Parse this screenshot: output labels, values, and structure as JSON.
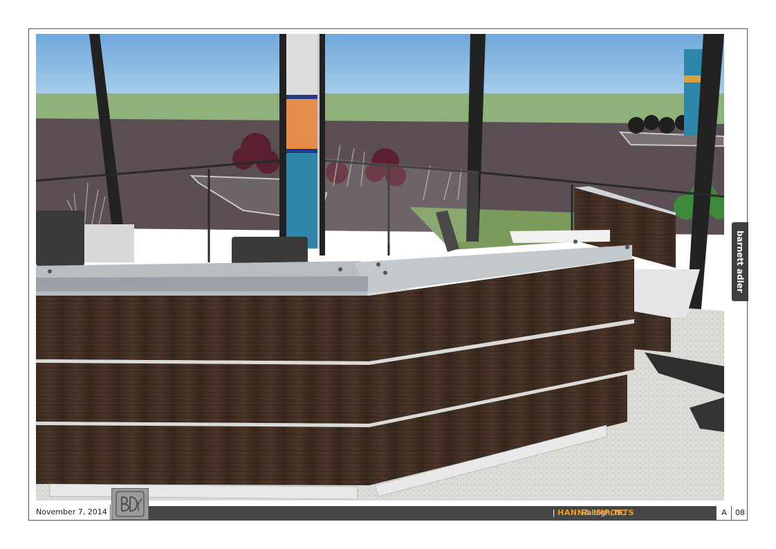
{
  "footer": {
    "date": "November 7, 2014",
    "location": "Raleigh, NC",
    "separator": "|",
    "client": "HANNA IMPORTS",
    "sheet_letter": "A",
    "page_number": "08"
  },
  "side_tab": {
    "brand": "barnett adler"
  },
  "logo": {
    "monogram": "BDY"
  },
  "render": {
    "icon": "reception-desk-rendering"
  }
}
